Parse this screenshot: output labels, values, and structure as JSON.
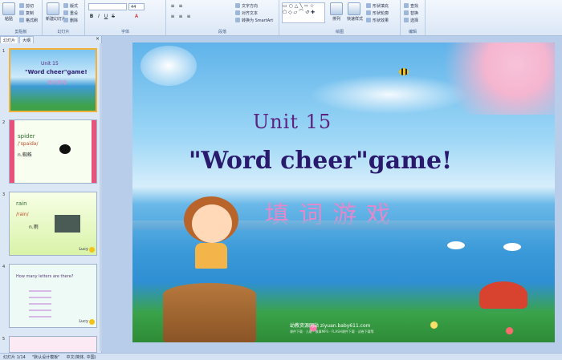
{
  "ribbon": {
    "clipboard": {
      "label": "剪贴板",
      "paste": "粘贴",
      "cut": "剪切",
      "copy": "复制",
      "format_painter": "格式刷"
    },
    "slides": {
      "label": "幻灯片",
      "new_slide": "新建幻灯片",
      "layout": "版式",
      "reset": "重设",
      "delete": "删除"
    },
    "font": {
      "label": "字体",
      "font_size": "44"
    },
    "paragraph": {
      "label": "段落",
      "text_direction": "文字方向",
      "align_text": "对齐文本",
      "smartart": "转换为 SmartArt"
    },
    "drawing": {
      "label": "绘图",
      "arrange": "排列",
      "quick_styles": "快速样式",
      "shape_fill": "形状填充",
      "shape_outline": "形状轮廓",
      "shape_effects": "形状效果"
    },
    "editing": {
      "label": "编辑",
      "find": "查找",
      "replace": "替换",
      "select": "选择"
    }
  },
  "panel": {
    "tab_slides": "幻灯片",
    "tab_outline": "大纲",
    "close": "×",
    "thumbs": [
      {
        "num": "1",
        "line1": "Unit 15",
        "line2": "\"Word cheer\"game!",
        "line3": "填词游戏"
      },
      {
        "num": "2",
        "line1": "spider",
        "line2": "/'spaidə/",
        "line3": "n.蜘蛛"
      },
      {
        "num": "3",
        "line1": "rain",
        "line2": "/rain/",
        "line3": "n.雨",
        "tag": "Lucy"
      },
      {
        "num": "4",
        "line1": "How many letters are there?",
        "tag": "Lucy"
      },
      {
        "num": "5"
      }
    ]
  },
  "slide": {
    "title1": "Unit 15",
    "title2": "\"Word cheer\"game!",
    "subtitle_cn": "填词游戏",
    "footer_site": "幼教资源网站 ziyuan.baby611.com",
    "footer_links": "课件下载 · 儿歌 · 故事MP3 · FLASH课件下载 · 试卷下载等"
  },
  "status": {
    "slide_pos": "幻灯片 1/14",
    "theme": "\"默认设计模板\"",
    "language": "中文(简体, 中国)"
  }
}
